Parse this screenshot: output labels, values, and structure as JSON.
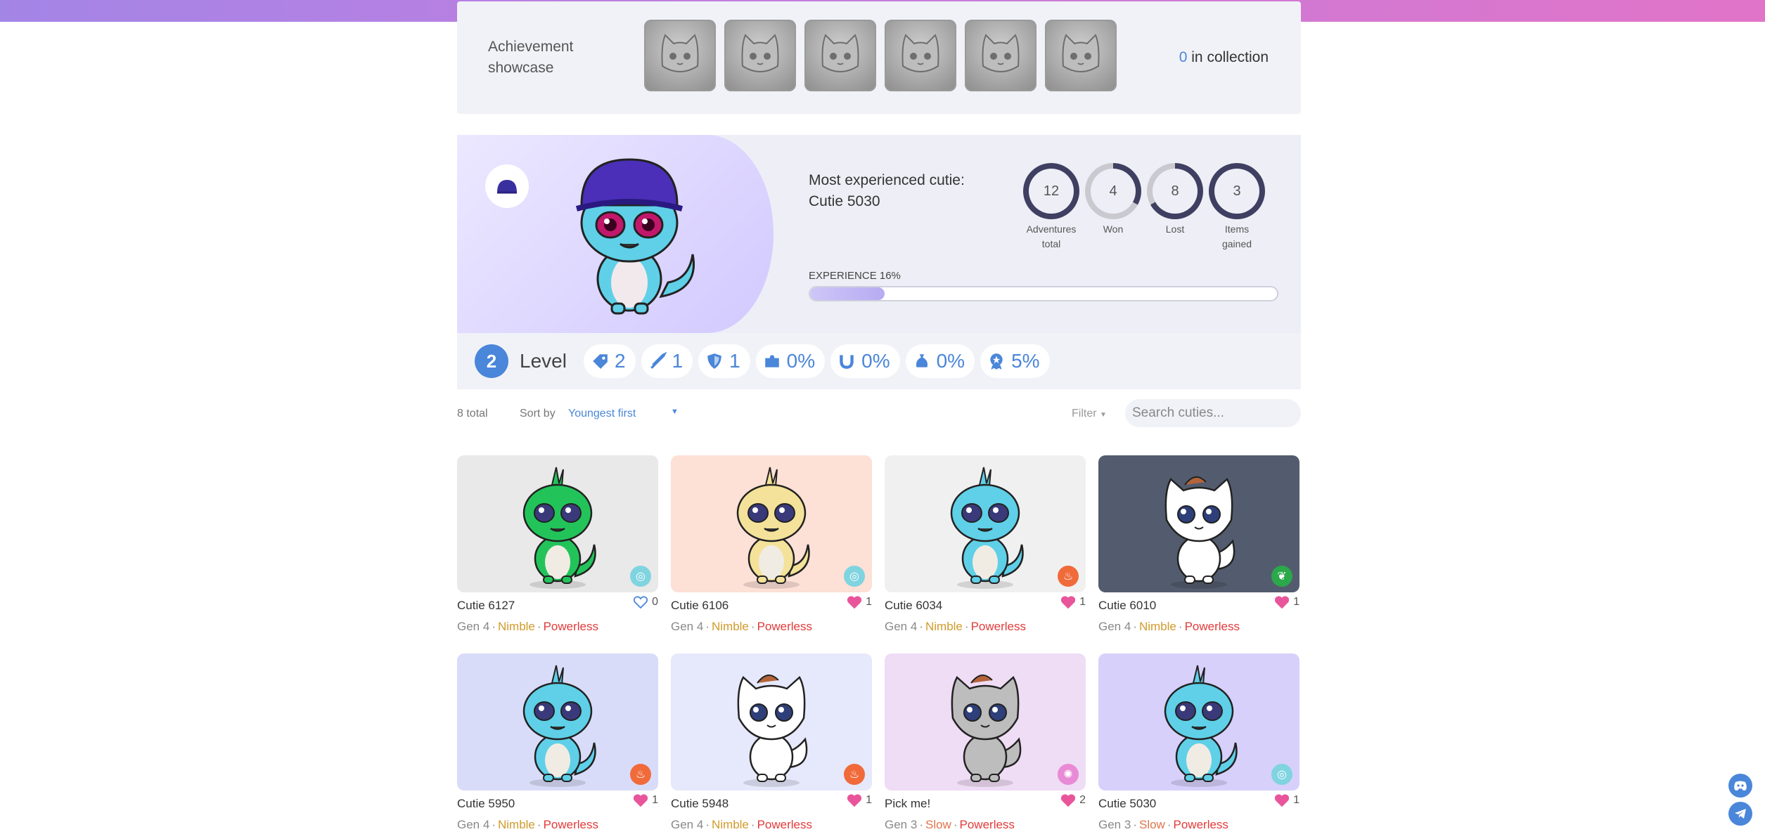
{
  "achievement": {
    "label": "Achievement showcase",
    "count": "0",
    "count_suffix": "in collection"
  },
  "hero": {
    "title_line1": "Most experienced cutie:",
    "title_line2": "Cutie 5030",
    "rings": [
      {
        "value": "12",
        "label1": "Adventures",
        "label2": "total",
        "fraction": 1.0
      },
      {
        "value": "4",
        "label1": "Won",
        "label2": "",
        "fraction": 0.33
      },
      {
        "value": "8",
        "label1": "Lost",
        "label2": "",
        "fraction": 0.67
      },
      {
        "value": "3",
        "label1": "Items",
        "label2": "gained",
        "fraction": 1.0
      }
    ],
    "experience_label": "EXPERIENCE 16%",
    "experience_fraction": 0.16
  },
  "stats": {
    "level_number": "2",
    "level_label": "Level",
    "pills": [
      {
        "icon": "tag-icon",
        "value": "2"
      },
      {
        "icon": "sword-icon",
        "value": "1"
      },
      {
        "icon": "shield-icon",
        "value": "1"
      },
      {
        "icon": "puzzle-icon",
        "value": "0%"
      },
      {
        "icon": "horseshoe-icon",
        "value": "0%"
      },
      {
        "icon": "money-bag-icon",
        "value": "0%"
      },
      {
        "icon": "medal-icon",
        "value": "5%"
      }
    ]
  },
  "sortbar": {
    "total": "8 total",
    "sort_by": "Sort by",
    "sort_value": "Youngest first",
    "filter": "Filter",
    "search_placeholder": "Search cuties..."
  },
  "cards": [
    {
      "name": "Cutie 6127",
      "likes": "0",
      "liked": false,
      "gen": "Gen 4",
      "speed": "Nimble",
      "power": "Powerless",
      "bg": "#e9e9e9",
      "body": "#22c45a",
      "element": "water",
      "elem_color": "#7fd4e0",
      "species": "lizard"
    },
    {
      "name": "Cutie 6106",
      "likes": "1",
      "liked": true,
      "gen": "Gen 4",
      "speed": "Nimble",
      "power": "Powerless",
      "bg": "#fde0d6",
      "body": "#f4e29a",
      "element": "water",
      "elem_color": "#7fd4e0",
      "species": "lizard"
    },
    {
      "name": "Cutie 6034",
      "likes": "1",
      "liked": true,
      "gen": "Gen 4",
      "speed": "Nimble",
      "power": "Powerless",
      "bg": "#f0f0f0",
      "body": "#5fd0e8",
      "element": "fire",
      "elem_color": "#f06a3a",
      "species": "lizard"
    },
    {
      "name": "Cutie 6010",
      "likes": "1",
      "liked": true,
      "gen": "Gen 4",
      "speed": "Nimble",
      "power": "Powerless",
      "bg": "#535c6e",
      "body": "#ffffff",
      "element": "nature",
      "elem_color": "#2aa84a",
      "species": "cat"
    },
    {
      "name": "Cutie 5950",
      "likes": "1",
      "liked": true,
      "gen": "Gen 4",
      "speed": "Nimble",
      "power": "Powerless",
      "bg": "#d9dcf8",
      "body": "#5fd0e8",
      "element": "fire",
      "elem_color": "#f06a3a",
      "species": "lizard"
    },
    {
      "name": "Cutie 5948",
      "likes": "1",
      "liked": true,
      "gen": "Gen 4",
      "speed": "Nimble",
      "power": "Powerless",
      "bg": "#e6e8fb",
      "body": "#ffffff",
      "element": "fire",
      "elem_color": "#f06a3a",
      "species": "cat"
    },
    {
      "name": "Pick me!",
      "likes": "2",
      "liked": true,
      "gen": "Gen 3",
      "speed": "Slow",
      "power": "Powerless",
      "bg": "#efdcf5",
      "body": "#bdbdbd",
      "element": "air",
      "elem_color": "#e88ad6",
      "species": "cat"
    },
    {
      "name": "Cutie 5030",
      "likes": "1",
      "liked": true,
      "gen": "Gen 3",
      "speed": "Slow",
      "power": "Powerless",
      "bg": "#d6d0fb",
      "body": "#5fd0e8",
      "element": "water",
      "elem_color": "#7fd4e0",
      "species": "lizard"
    }
  ]
}
